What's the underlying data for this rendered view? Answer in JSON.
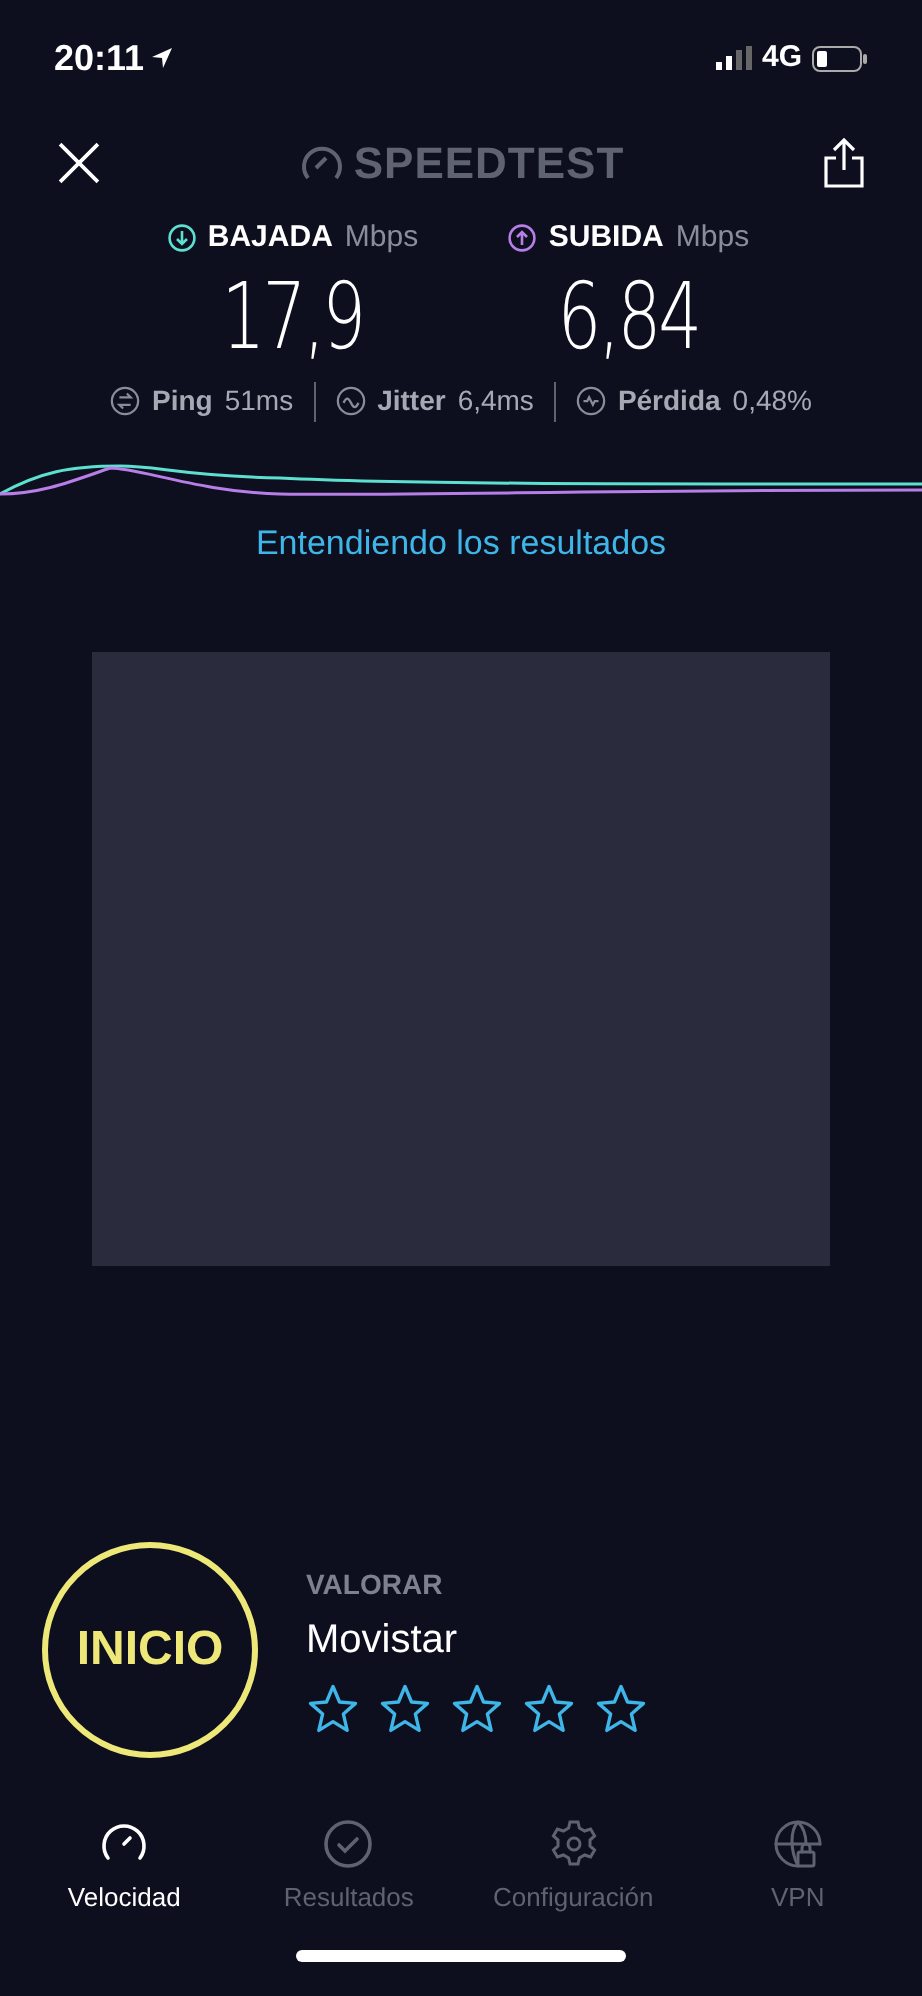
{
  "status_bar": {
    "time": "20:11",
    "network": "4G"
  },
  "header": {
    "title": "SPEEDTEST"
  },
  "results": [
    {
      "kind": "download",
      "label": "BAJADA",
      "unit": "Mbps",
      "value": "17,9",
      "color": "#5ee0d0"
    },
    {
      "kind": "upload",
      "label": "SUBIDA",
      "unit": "Mbps",
      "value": "6,84",
      "color": "#b77ee8"
    }
  ],
  "stats": [
    {
      "kind": "ping",
      "label": "Ping",
      "value": "51ms"
    },
    {
      "kind": "jitter",
      "label": "Jitter",
      "value": "6,4ms"
    },
    {
      "kind": "loss",
      "label": "Pérdida",
      "value": "0,48%"
    }
  ],
  "link": "Entendiendo los resultados",
  "start_button": "INICIO",
  "rating": {
    "heading": "VALORAR",
    "provider": "Movistar",
    "stars": 0
  },
  "tabs": [
    {
      "kind": "speed",
      "label": "Velocidad",
      "selected": true
    },
    {
      "kind": "results",
      "label": "Resultados",
      "selected": false
    },
    {
      "kind": "settings",
      "label": "Configuración",
      "selected": false
    },
    {
      "kind": "vpn",
      "label": "VPN",
      "selected": false
    }
  ]
}
